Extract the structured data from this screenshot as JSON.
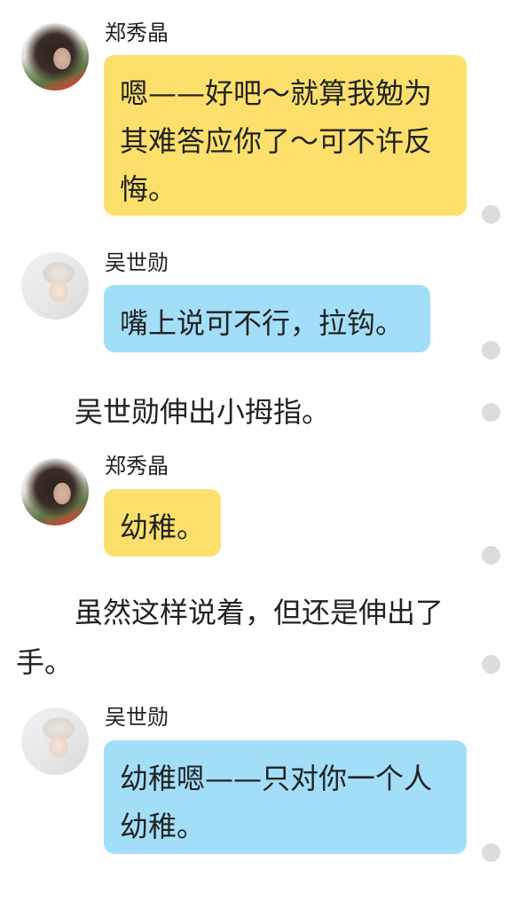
{
  "messages": [
    {
      "speaker": "郑秀晶",
      "text": "嗯——好吧～就算我勉为其难答应你了～可不许反悔。"
    },
    {
      "speaker": "吴世勋",
      "text": "嘴上说可不行，拉钩。"
    },
    {
      "narration": "吴世勋伸出小拇指。"
    },
    {
      "speaker": "郑秀晶",
      "text": "幼稚。"
    },
    {
      "narration": "虽然这样说着，但还是伸出了手。"
    },
    {
      "speaker": "吴世勋",
      "text": "幼稚嗯——只对你一个人幼稚。"
    }
  ],
  "colors": {
    "female_bubble": "#fde06b",
    "male_bubble": "#a3def8",
    "status_dot": "#dcdcdc"
  }
}
